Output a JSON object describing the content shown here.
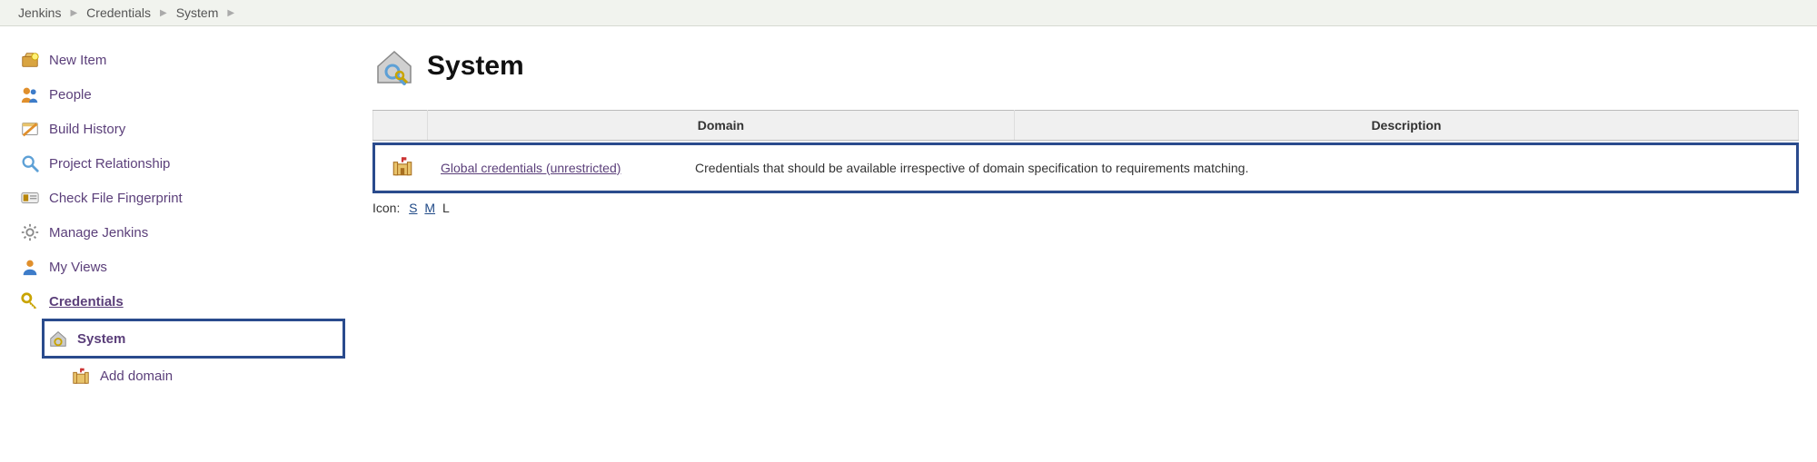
{
  "breadcrumbs": {
    "items": [
      {
        "label": "Jenkins"
      },
      {
        "label": "Credentials"
      },
      {
        "label": "System"
      }
    ]
  },
  "sidebar": {
    "items": [
      {
        "label": "New Item"
      },
      {
        "label": "People"
      },
      {
        "label": "Build History"
      },
      {
        "label": "Project Relationship"
      },
      {
        "label": "Check File Fingerprint"
      },
      {
        "label": "Manage Jenkins"
      },
      {
        "label": "My Views"
      },
      {
        "label": "Credentials"
      }
    ],
    "sub": {
      "system": "System",
      "add_domain": "Add domain"
    }
  },
  "page": {
    "title": "System"
  },
  "table": {
    "headers": {
      "col1": "",
      "col2": "Domain",
      "col3": "Description"
    },
    "rows": [
      {
        "domain": "Global credentials (unrestricted)",
        "description": "Credentials that should be available irrespective of domain specification to requirements matching."
      }
    ]
  },
  "icon_size": {
    "label": "Icon:",
    "s": "S",
    "m": "M",
    "l": "L"
  }
}
